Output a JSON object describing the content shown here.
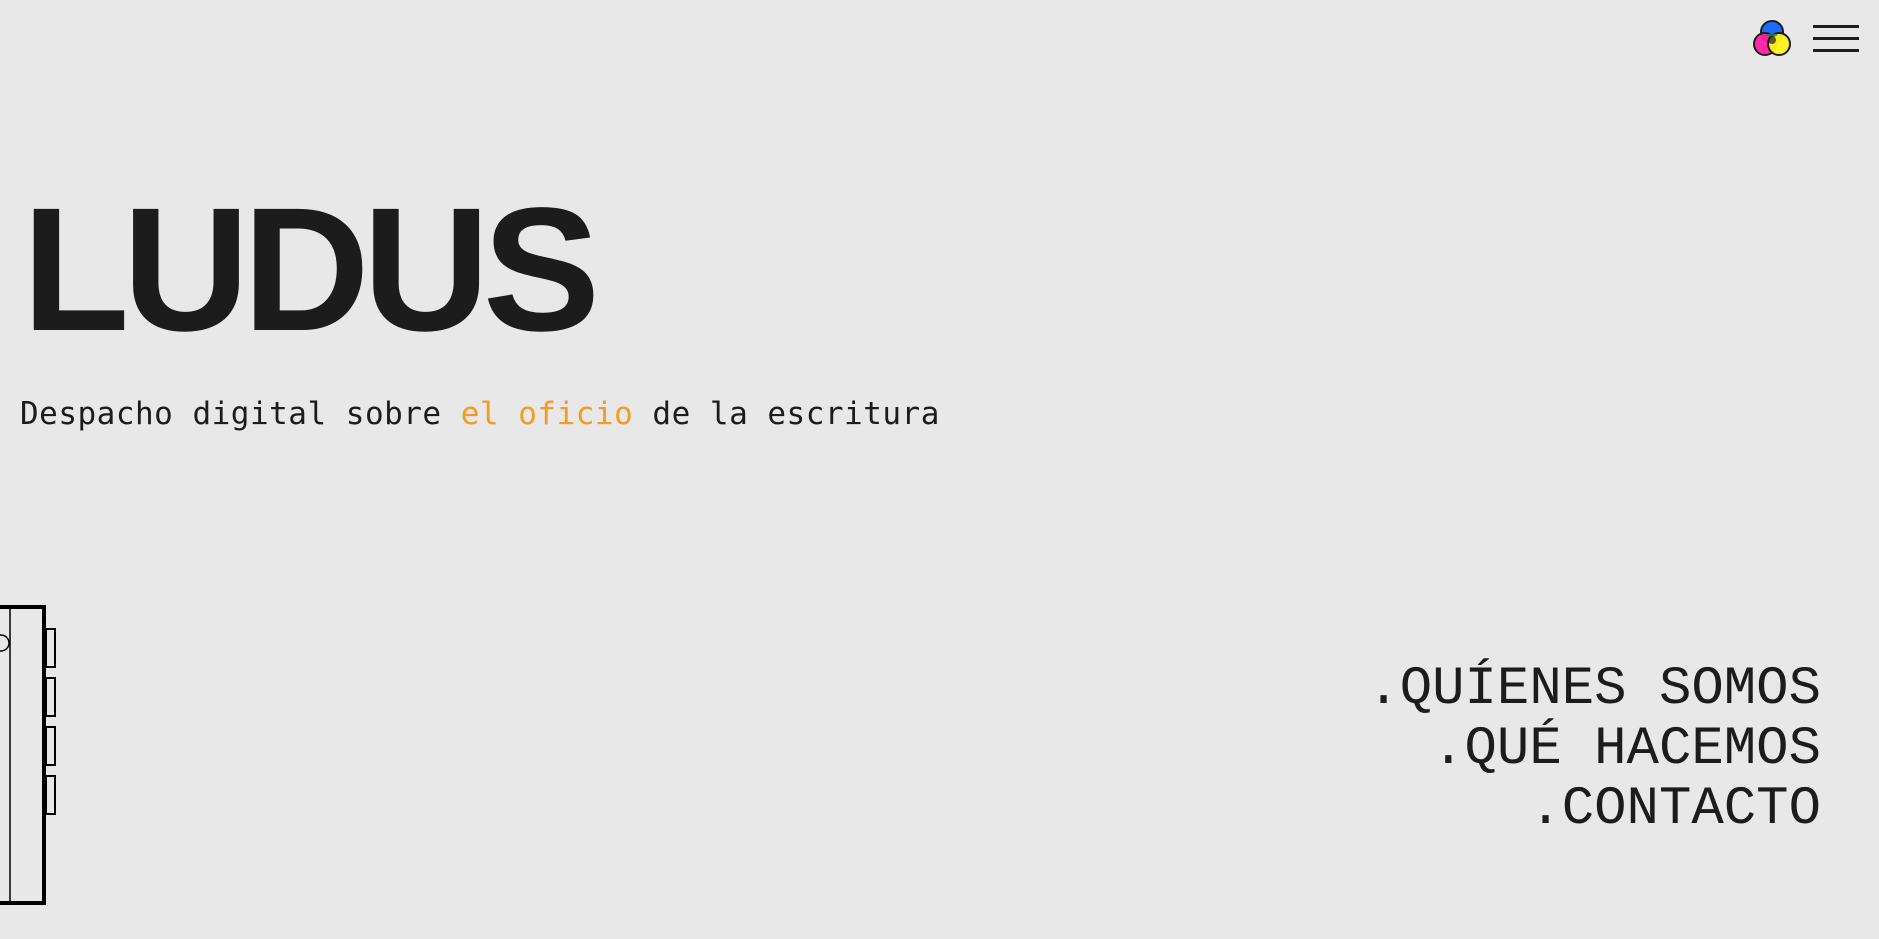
{
  "brand": {
    "logo_text": "LUDUS"
  },
  "tagline": {
    "before": "Despacho digital sobre ",
    "highlight": "el oficio",
    "after": " de la escritura",
    "highlight_color": "#f59a23"
  },
  "header": {
    "color_toggle_icon": "rgb-circles-icon",
    "menu_icon": "hamburger-menu-icon"
  },
  "nav": {
    "items": [
      {
        "label": ".QUÍENES SOMOS"
      },
      {
        "label": ".QUÉ HACEMOS"
      },
      {
        "label": ".CONTACTO"
      }
    ]
  },
  "colors": {
    "background": "#e8e8e8",
    "text": "#1c1c1c",
    "accent": "#f59a23"
  },
  "illustration": {
    "icon": "door-illustration"
  }
}
